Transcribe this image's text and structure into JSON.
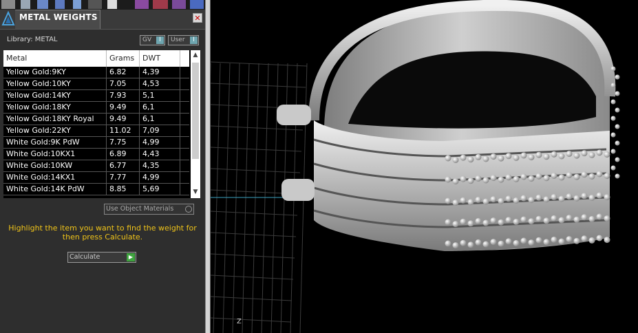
{
  "panel": {
    "title": "METAL WEIGHTS",
    "close_glyph": "✕",
    "library_label": "Library: METAL",
    "toggles": [
      {
        "label": "GV",
        "glyph": "I"
      },
      {
        "label": "User",
        "glyph": "I"
      }
    ],
    "table": {
      "columns": [
        "Metal",
        "Grams",
        "DWT"
      ],
      "rows": [
        {
          "metal": "Yellow Gold:9KY",
          "grams": "6.82",
          "dwt": "4,39"
        },
        {
          "metal": "Yellow Gold:10KY",
          "grams": "7.05",
          "dwt": "4,53"
        },
        {
          "metal": "Yellow Gold:14KY",
          "grams": "7.93",
          "dwt": "5,1"
        },
        {
          "metal": "Yellow Gold:18KY",
          "grams": "9.49",
          "dwt": "6,1"
        },
        {
          "metal": "Yellow Gold:18KY Royal",
          "grams": "9.49",
          "dwt": "6,1"
        },
        {
          "metal": "Yellow Gold:22KY",
          "grams": "11.02",
          "dwt": "7,09"
        },
        {
          "metal": "White Gold:9K PdW",
          "grams": "7.75",
          "dwt": "4,99"
        },
        {
          "metal": "White Gold:10KX1",
          "grams": "6.89",
          "dwt": "4,43"
        },
        {
          "metal": "White Gold:10KW",
          "grams": "6.77",
          "dwt": "4,35"
        },
        {
          "metal": "White Gold:14KX1",
          "grams": "7.77",
          "dwt": "4,99"
        },
        {
          "metal": "White Gold:14K PdW",
          "grams": "8.85",
          "dwt": "5,69"
        }
      ]
    },
    "use_object_materials": "Use Object Materials",
    "hint": "Highlight the item you want to find the weight for then press Calculate.",
    "calculate_label": "Calculate",
    "calculate_glyph": "▶"
  },
  "viewport": {
    "axis_label": "Z"
  },
  "colors": {
    "panel_bg": "#2e2e2e",
    "hint": "#f0c419",
    "viewport_bg": "#000000"
  }
}
